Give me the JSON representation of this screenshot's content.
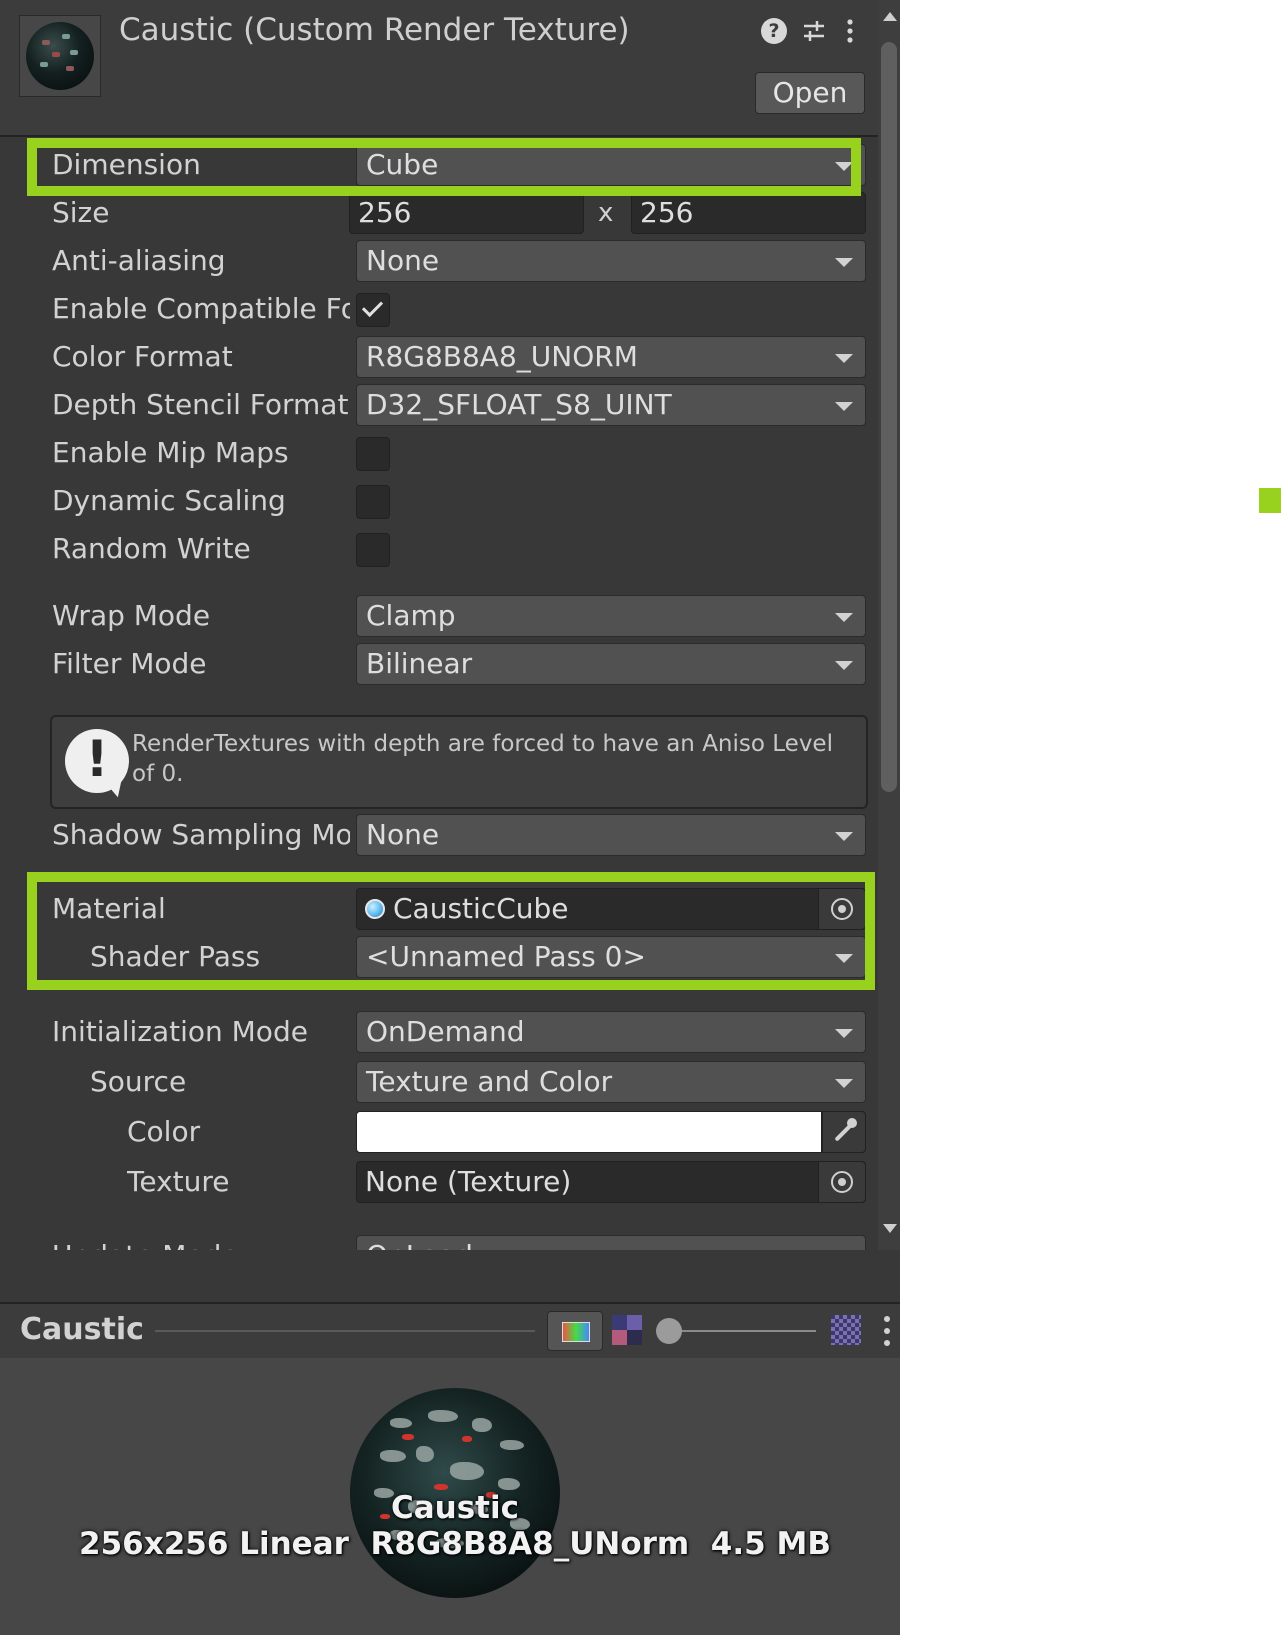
{
  "header": {
    "title": "Caustic (Custom Render Texture)",
    "help_icon": "?",
    "open_label": "Open"
  },
  "fields": {
    "dimension": {
      "label": "Dimension",
      "value": "Cube"
    },
    "size": {
      "label": "Size",
      "width": "256",
      "separator": "x",
      "height": "256"
    },
    "anti_aliasing": {
      "label": "Anti-aliasing",
      "value": "None"
    },
    "enable_compatible_format": {
      "label": "Enable Compatible Fo",
      "checked": true
    },
    "color_format": {
      "label": "Color Format",
      "value": "R8G8B8A8_UNORM"
    },
    "depth_stencil_format": {
      "label": "Depth Stencil Format",
      "value": "D32_SFLOAT_S8_UINT"
    },
    "enable_mip_maps": {
      "label": "Enable Mip Maps",
      "checked": false
    },
    "dynamic_scaling": {
      "label": "Dynamic Scaling",
      "checked": false
    },
    "random_write": {
      "label": "Random Write",
      "checked": false
    },
    "wrap_mode": {
      "label": "Wrap Mode",
      "value": "Clamp"
    },
    "filter_mode": {
      "label": "Filter Mode",
      "value": "Bilinear"
    },
    "help_message": "RenderTextures with depth are forced to have an Aniso Level of 0.",
    "shadow_sampling_mode": {
      "label": "Shadow Sampling Mo",
      "value": "None"
    },
    "material": {
      "label": "Material",
      "value": "CausticCube"
    },
    "shader_pass": {
      "label": "Shader Pass",
      "value": "<Unnamed Pass 0>"
    },
    "initialization_mode": {
      "label": "Initialization Mode",
      "value": "OnDemand"
    },
    "source": {
      "label": "Source",
      "value": "Texture and Color"
    },
    "color": {
      "label": "Color",
      "value": "#ffffff"
    },
    "texture": {
      "label": "Texture",
      "value": "None (Texture)"
    },
    "update_mode": {
      "label": "Update Mode",
      "value": "OnLoad"
    }
  },
  "preview": {
    "title": "Caustic",
    "name": "Caustic",
    "info": "256x256 Linear  R8G8B8A8_UNorm  4.5 MB"
  },
  "colors": {
    "highlight": "#98d21e",
    "panel_bg": "#383838",
    "field_bg": "#515151"
  },
  "icons": [
    "help-icon",
    "preset-sliders-icon",
    "kebab-menu-icon",
    "object-picker-icon",
    "eyedropper-icon",
    "warning-icon",
    "material-sphere-icon",
    "rgb-channel-icon",
    "mip-level-icon"
  ]
}
